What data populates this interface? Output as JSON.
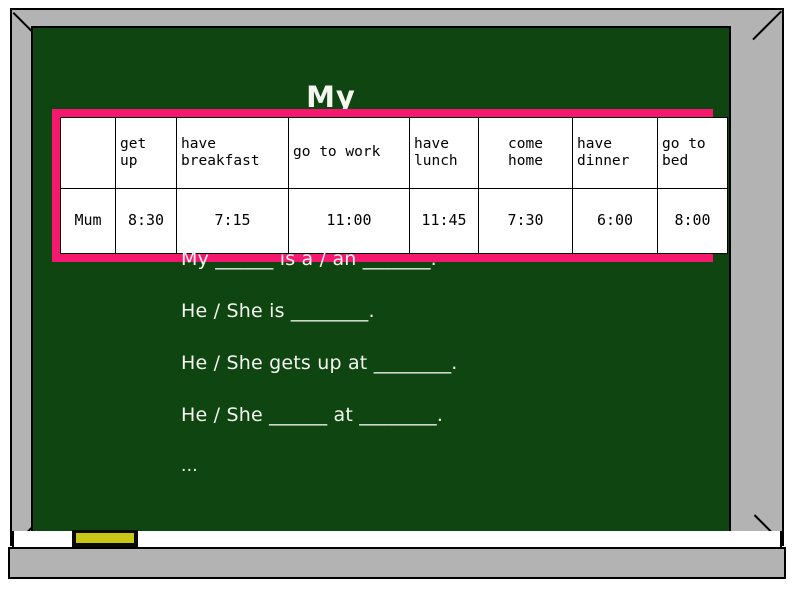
{
  "board": {
    "title": "My ______",
    "colors": {
      "board_green": "#0f4511",
      "frame_gray": "#b3b3b3",
      "table_border_pink": "#f5186e",
      "chalk_white": "#f4f6ef",
      "eraser_yellow": "#c8c814"
    }
  },
  "table": {
    "header": [
      {
        "text": "",
        "lines": [
          ""
        ],
        "align": "center"
      },
      {
        "text": "get up",
        "lines": [
          "get",
          "up"
        ],
        "align": "left"
      },
      {
        "text": "have breakfast",
        "lines": [
          "have",
          "breakfast"
        ],
        "align": "left"
      },
      {
        "text": "go to work",
        "lines": [
          "go to work"
        ],
        "align": "left"
      },
      {
        "text": "have lunch",
        "lines": [
          "have",
          "lunch"
        ],
        "align": "left"
      },
      {
        "text": "come home",
        "lines": [
          "come",
          "home"
        ],
        "align": "center"
      },
      {
        "text": "have dinner",
        "lines": [
          "have",
          "dinner"
        ],
        "align": "left"
      },
      {
        "text": "go to bed",
        "lines": [
          "go to",
          "bed"
        ],
        "align": "left"
      }
    ],
    "rows": [
      {
        "label": "Mum",
        "times": [
          "8:30",
          "7:15",
          "11:00",
          "11:45",
          "7:30",
          "6:00",
          "8:00"
        ]
      }
    ]
  },
  "sentences": [
    "My ______ is a / an _______.",
    "He / She is ________.",
    "He / She gets up at ________.",
    "He / She ______ at ________.",
    "..."
  ]
}
